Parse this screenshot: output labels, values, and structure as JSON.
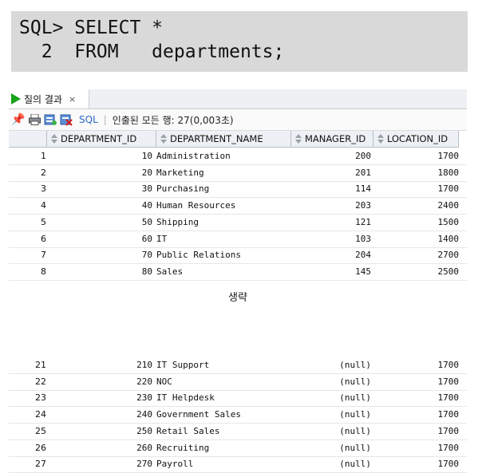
{
  "sql": {
    "line1": "SQL> SELECT *",
    "line2": "  2  FROM   departments;"
  },
  "tab": {
    "label": "질의 결과",
    "close": "×"
  },
  "toolbar": {
    "sql_link": "SQL",
    "separator": "|",
    "fetch_text": "인출된 모든 행: 27(0,003초)"
  },
  "columns": [
    "DEPARTMENT_ID",
    "DEPARTMENT_NAME",
    "MANAGER_ID",
    "LOCATION_ID"
  ],
  "rows_top": [
    [
      "1",
      "10",
      "Administration",
      "200",
      "1700"
    ],
    [
      "2",
      "20",
      "Marketing",
      "201",
      "1800"
    ],
    [
      "3",
      "30",
      "Purchasing",
      "114",
      "1700"
    ],
    [
      "4",
      "40",
      "Human Resources",
      "203",
      "2400"
    ],
    [
      "5",
      "50",
      "Shipping",
      "121",
      "1500"
    ],
    [
      "6",
      "60",
      "IT",
      "103",
      "1400"
    ],
    [
      "7",
      "70",
      "Public Relations",
      "204",
      "2700"
    ],
    [
      "8",
      "80",
      "Sales",
      "145",
      "2500"
    ]
  ],
  "omitted_label": "생략",
  "rows_bottom": [
    [
      "21",
      "210",
      "IT Support",
      "(null)",
      "1700"
    ],
    [
      "22",
      "220",
      "NOC",
      "(null)",
      "1700"
    ],
    [
      "23",
      "230",
      "IT Helpdesk",
      "(null)",
      "1700"
    ],
    [
      "24",
      "240",
      "Government Sales",
      "(null)",
      "1700"
    ],
    [
      "25",
      "250",
      "Retail Sales",
      "(null)",
      "1700"
    ],
    [
      "26",
      "260",
      "Recruiting",
      "(null)",
      "1700"
    ],
    [
      "27",
      "270",
      "Payroll",
      "(null)",
      "1700"
    ]
  ],
  "icons": [
    "pin-icon",
    "print-icon",
    "export-icon",
    "delete-icon"
  ],
  "colors": {
    "run_green": "#19a31b",
    "pin_red": "#e0201f",
    "sql_link": "#2a68c7"
  }
}
